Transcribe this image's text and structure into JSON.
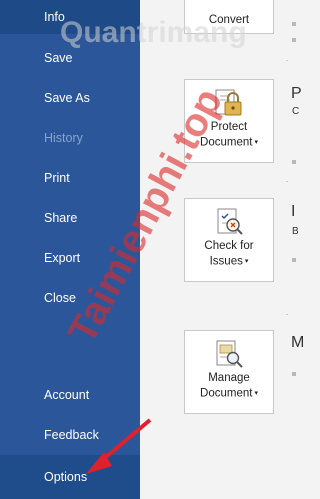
{
  "sidebar": {
    "items": [
      {
        "label": "Info",
        "state": "active"
      },
      {
        "label": "Save",
        "state": "normal"
      },
      {
        "label": "Save As",
        "state": "normal"
      },
      {
        "label": "History",
        "state": "disabled"
      },
      {
        "label": "Print",
        "state": "normal"
      },
      {
        "label": "Share",
        "state": "normal"
      },
      {
        "label": "Export",
        "state": "normal"
      },
      {
        "label": "Close",
        "state": "normal"
      },
      {
        "label": "Account",
        "state": "normal"
      },
      {
        "label": "Feedback",
        "state": "normal"
      },
      {
        "label": "Options",
        "state": "highlighted"
      }
    ]
  },
  "main": {
    "tiles": [
      {
        "line1": "Convert",
        "line2": "",
        "icon": "convert-icon"
      },
      {
        "line1": "Protect",
        "line2": "Document",
        "icon": "lock-document-icon"
      },
      {
        "line1": "Check for",
        "line2": "Issues",
        "icon": "inspect-document-icon"
      },
      {
        "line1": "Manage",
        "line2": "Document",
        "icon": "manage-document-icon"
      }
    ],
    "side_snippets": [
      {
        "big": "P",
        "small": "C"
      },
      {
        "big": "I",
        "small": "B"
      },
      {
        "big": "M",
        "small": ""
      }
    ],
    "caret": "▾"
  },
  "watermark": {
    "top": "Quantrimang",
    "diagonal": "Taimienphi.top"
  },
  "colors": {
    "sidebar_bg": "#2b579a",
    "arrow": "#e0202a"
  }
}
